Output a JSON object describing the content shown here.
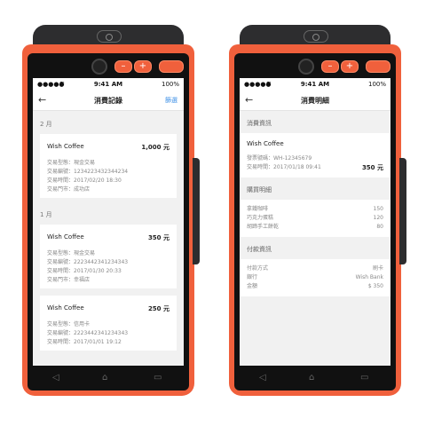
{
  "status": {
    "signal": "●●●●●",
    "wifi": "≋",
    "time": "9:41 AM",
    "battery": "100%"
  },
  "left": {
    "title": "消費記錄",
    "filter": "篩選",
    "back": "←",
    "groups": [
      {
        "month": "2 月",
        "cards": [
          {
            "merchant": "Wish Coffee",
            "amount": "1,000 元",
            "rows": [
              "交易型態：現金交易",
              "交易編號：1234223432344234",
              "交易時間：2017/02/20 18:30",
              "交易門市：成功店"
            ]
          }
        ]
      },
      {
        "month": "1 月",
        "cards": [
          {
            "merchant": "Wish Coffee",
            "amount": "350 元",
            "rows": [
              "交易型態：現金交易",
              "交易編號：2223442341234343",
              "交易時間：2017/01/30 20:33",
              "交易門市：幸福店"
            ]
          },
          {
            "merchant": "Wish Coffee",
            "amount": "250 元",
            "rows": [
              "交易型態：信用卡",
              "交易編號：2223442341234343",
              "交易時間：2017/01/01 19:12"
            ]
          }
        ]
      }
    ]
  },
  "right": {
    "title": "消費明細",
    "back": "←",
    "consume_section": "消費資訊",
    "merchant": "Wish Coffee",
    "invoice": "發票號碼：WH-12345679",
    "trans_time": "交易時間：2017/01/18 09:41",
    "total": "350 元",
    "purchase_section": "購買明細",
    "items": [
      {
        "name": "拿鐵咖啡",
        "price": "150"
      },
      {
        "name": "巧克力蛋糕",
        "price": "120"
      },
      {
        "name": "胡蹄手工餅乾",
        "price": "80"
      }
    ],
    "pay_section": "付款資訊",
    "pay": [
      {
        "k": "付款方式",
        "v": "刷卡"
      },
      {
        "k": "銀行",
        "v": "Wish Bank"
      },
      {
        "k": "金額",
        "v": "$ 350"
      }
    ]
  },
  "hardware": {
    "minus": "–",
    "plus": "+",
    "nav_back": "◁",
    "nav_home": "⌂",
    "nav_recent": "▭"
  },
  "colors": {
    "device_orange": "#f0603c",
    "accent_blue": "#3a8ee6"
  }
}
